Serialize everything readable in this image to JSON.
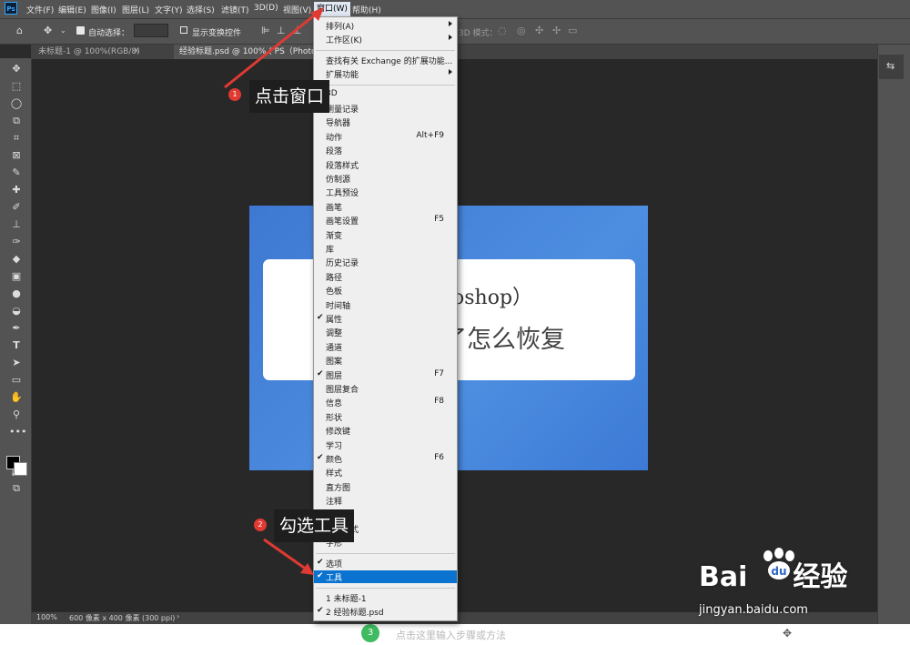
{
  "app": {
    "logo": "Ps"
  },
  "menubar": {
    "items": [
      "文件(F)",
      "编辑(E)",
      "图像(I)",
      "图层(L)",
      "文字(Y)",
      "选择(S)",
      "滤镜(T)",
      "3D(D)",
      "视图(V)",
      "窗口(W)",
      "帮助(H)"
    ],
    "active": "窗口(W)"
  },
  "options": {
    "auto_select_label": "自动选择：",
    "layer_value": "图层",
    "transform_label": "显示变换控件",
    "mode3d_label": "3D 模式："
  },
  "tabs": [
    {
      "label": "未标题-1 @ 100%(RGB/8)"
    },
    {
      "label": "经验标题.psd @ 100% (   PS（Photoshop）工"
    }
  ],
  "canvas": {
    "text_line1": "oshop）",
    "text_line2": "了怎么恢复"
  },
  "window_menu": {
    "items": [
      {
        "label": "排列(A)",
        "submenu": true
      },
      {
        "label": "工作区(K)",
        "submenu": true
      },
      {
        "sep": true
      },
      {
        "label": "查找有关 Exchange 的扩展功能..."
      },
      {
        "label": "扩展功能",
        "submenu": true
      },
      {
        "sep": true
      },
      {
        "label": "3D"
      },
      {
        "label": "测量记录"
      },
      {
        "label": "导航器"
      },
      {
        "label": "动作",
        "shortcut": "Alt+F9"
      },
      {
        "label": "段落"
      },
      {
        "label": "段落样式"
      },
      {
        "label": "仿制源"
      },
      {
        "label": "工具预设"
      },
      {
        "label": "画笔"
      },
      {
        "label": "画笔设置",
        "shortcut": "F5"
      },
      {
        "label": "渐变"
      },
      {
        "label": "库"
      },
      {
        "label": "历史记录"
      },
      {
        "label": "路径"
      },
      {
        "label": "色板"
      },
      {
        "label": "时间轴"
      },
      {
        "label": "属性",
        "checked": true
      },
      {
        "label": "调整"
      },
      {
        "label": "通道"
      },
      {
        "label": "图案"
      },
      {
        "label": "图层",
        "checked": true,
        "shortcut": "F7"
      },
      {
        "label": "图层复合"
      },
      {
        "label": "信息",
        "shortcut": "F8"
      },
      {
        "label": "形状"
      },
      {
        "label": "修改键"
      },
      {
        "label": "学习"
      },
      {
        "label": "颜色",
        "checked": true,
        "shortcut": "F6"
      },
      {
        "label": "样式"
      },
      {
        "label": "直方图"
      },
      {
        "label": "注释"
      },
      {
        "label": "字符"
      },
      {
        "label": "字符样式"
      },
      {
        "label": "字形"
      },
      {
        "sep": true
      },
      {
        "label": "选项",
        "checked": true
      },
      {
        "label": "工具",
        "checked": true,
        "highlighted": true
      },
      {
        "sep": true
      },
      {
        "label": "1 未标题-1"
      },
      {
        "label": "2 经验标题.psd",
        "checked": true
      }
    ]
  },
  "annotations": [
    {
      "num": "1",
      "text": "点击窗口"
    },
    {
      "num": "2",
      "text": "勾选工具"
    }
  ],
  "statusbar": {
    "zoom": "100%",
    "info": "600 像素 x 400 像素 (300 ppi)"
  },
  "footer": {
    "step_number": "3",
    "placeholder": "点击这里输入步骤或方法"
  },
  "watermark": {
    "brand_left": "Bai",
    "brand_right": "经验",
    "url": "jingyan.baidu.com"
  },
  "colors": {
    "menu_highlight": "#0a73d0",
    "callout_badge": "#e03a32",
    "arrow": "#e03a32",
    "step_badge": "#3fbc61"
  }
}
